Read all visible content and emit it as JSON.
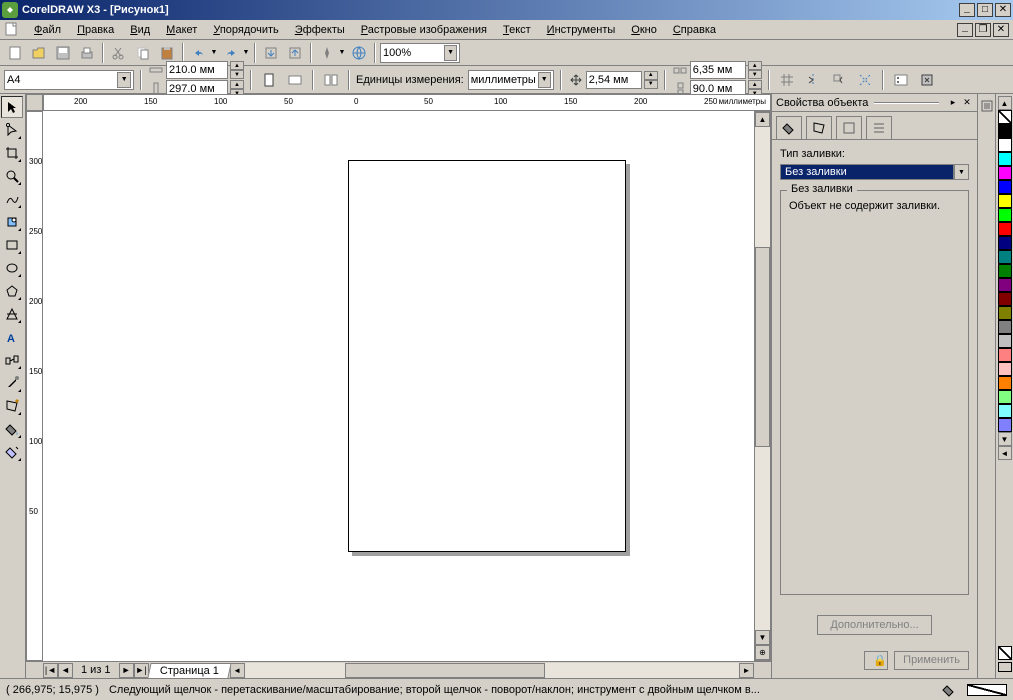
{
  "titlebar": {
    "app_name": "CorelDRAW X3",
    "document": "[Рисунок1]"
  },
  "menu": {
    "file": "Файл",
    "edit": "Правка",
    "view": "Вид",
    "layout": "Макет",
    "arrange": "Упорядочить",
    "effects": "Эффекты",
    "bitmaps": "Растровые изображения",
    "text": "Текст",
    "tools": "Инструменты",
    "window": "Окно",
    "help": "Справка"
  },
  "toolbar": {
    "zoom_value": "100%"
  },
  "propbar": {
    "paper_size": "A4",
    "width": "210.0 мм",
    "height": "297.0 мм",
    "units_label": "Единицы измерения:",
    "units_value": "миллиметры",
    "nudge": "2,54 мм",
    "dup_x": "6,35 мм",
    "dup_y": "90.0 мм"
  },
  "ruler": {
    "h_marks": [
      "200",
      "150",
      "100",
      "50",
      "0",
      "50",
      "100",
      "150",
      "200",
      "250"
    ],
    "h_unit": "миллиметры",
    "v_marks": [
      "300",
      "250",
      "200",
      "150",
      "100",
      "50"
    ],
    "v_unit": "миллиметры"
  },
  "pagenav": {
    "count_text": "1 из 1",
    "tab_label": "Страница 1"
  },
  "docker": {
    "title": "Свойства объекта",
    "fill_type_label": "Тип заливки:",
    "fill_type_value": "Без заливки",
    "frame_title": "Без заливки",
    "frame_text": "Объект не содержит заливки.",
    "advanced_btn": "Дополнительно...",
    "apply_btn": "Применить"
  },
  "palette_colors": [
    "#000000",
    "#ffffff",
    "#00ffff",
    "#ff00ff",
    "#0000ff",
    "#ffff00",
    "#00ff00",
    "#ff0000",
    "#000080",
    "#008080",
    "#008000",
    "#800080",
    "#800000",
    "#808000",
    "#808080",
    "#c0c0c0",
    "#ff8080",
    "#ffc0c0",
    "#ff8000",
    "#80ff80",
    "#80ffff",
    "#8080ff"
  ],
  "statusbar": {
    "coords": "( 266,975; 15,975 )",
    "hint": "Следующий щелчок - перетаскивание/масштабирование; второй щелчок - поворот/наклон; инструмент с двойным щелчком в..."
  }
}
